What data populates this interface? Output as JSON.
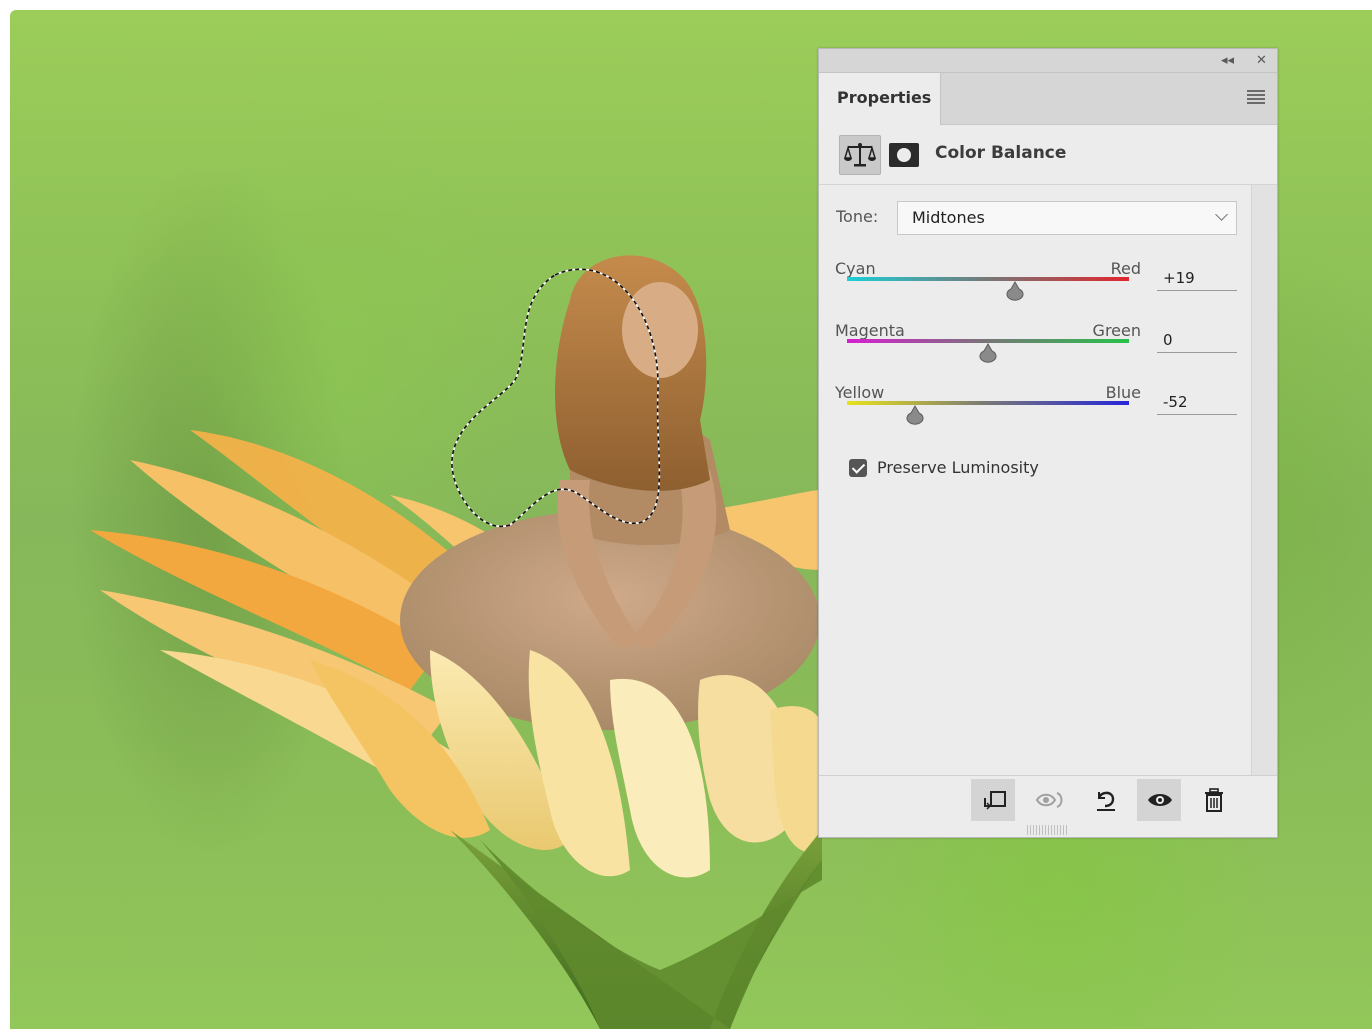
{
  "panel": {
    "title": "Properties",
    "collapse_label": "◂◂",
    "close_label": "✕",
    "menu_icon": "hamburger-menu-icon",
    "adjustment_name": "Color Balance",
    "adjustment_icon": "balance-scale-icon",
    "mask_icon": "layer-mask-icon"
  },
  "tone": {
    "label": "Tone:",
    "selected": "Midtones"
  },
  "sliders": [
    {
      "left": "Cyan",
      "right": "Red",
      "value": "+19",
      "numeric": 19,
      "min": -100,
      "max": 100,
      "colors": [
        "#1ccfd6",
        "#777777",
        "#e1262c"
      ]
    },
    {
      "left": "Magenta",
      "right": "Green",
      "value": "0",
      "numeric": 0,
      "min": -100,
      "max": 100,
      "colors": [
        "#d61fd0",
        "#777777",
        "#27c24a"
      ]
    },
    {
      "left": "Yellow",
      "right": "Blue",
      "value": "-52",
      "numeric": -52,
      "min": -100,
      "max": 100,
      "colors": [
        "#e8e21c",
        "#777777",
        "#2626d9"
      ]
    }
  ],
  "preserve_luminosity": {
    "label": "Preserve Luminosity",
    "checked": true
  },
  "footer_buttons": [
    {
      "name": "clip-to-layer-button",
      "icon": "clip-to-layer-icon",
      "active": true
    },
    {
      "name": "view-previous-state-button",
      "icon": "view-previous-icon",
      "active": false
    },
    {
      "name": "reset-button",
      "icon": "reset-icon",
      "active": false
    },
    {
      "name": "toggle-visibility-button",
      "icon": "eye-icon",
      "active": true
    },
    {
      "name": "delete-button",
      "icon": "trash-icon",
      "active": false
    }
  ]
}
